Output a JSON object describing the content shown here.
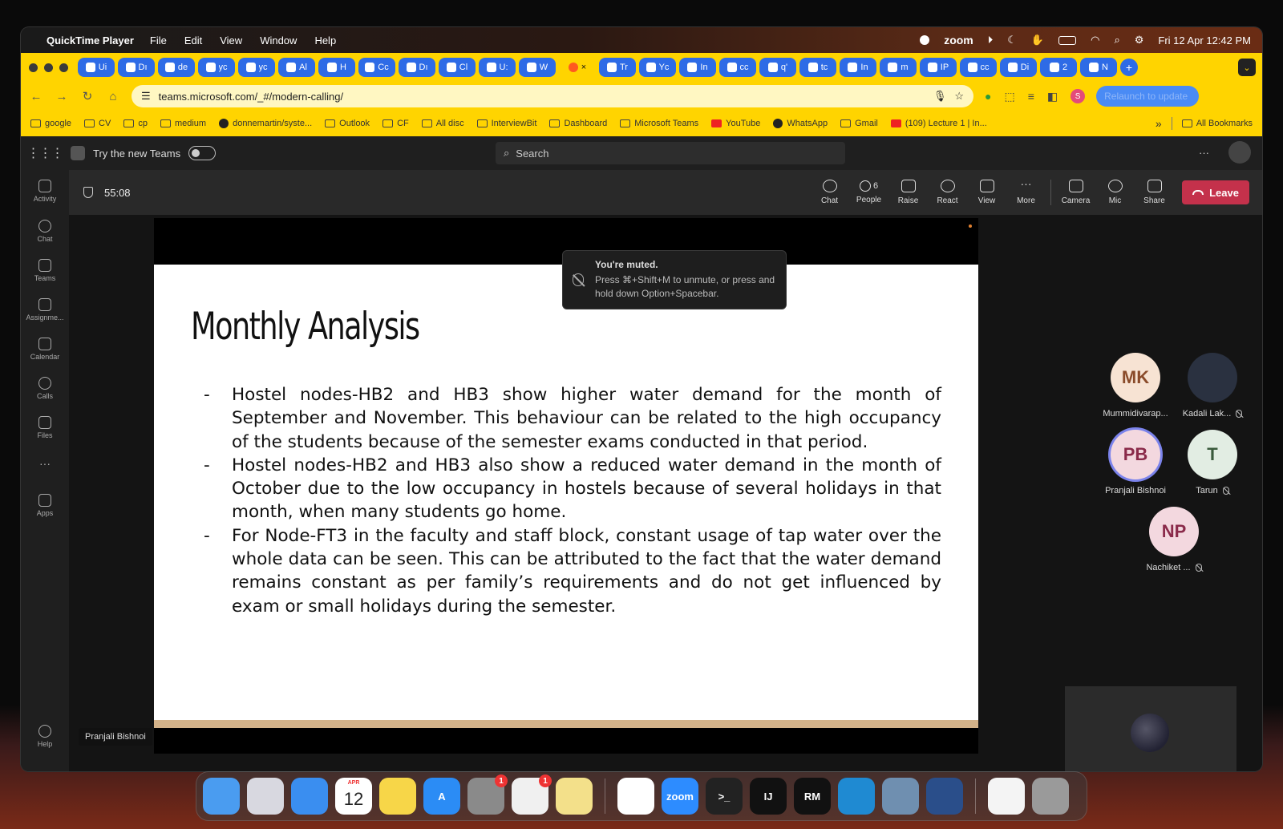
{
  "menubar": {
    "app_name": "QuickTime Player",
    "menus": [
      "File",
      "Edit",
      "View",
      "Window",
      "Help"
    ],
    "zoom_label": "zoom",
    "datetime": "Fri 12 Apr  12:42 PM"
  },
  "browser": {
    "tabs": [
      {
        "label": "Ui"
      },
      {
        "label": "Dı"
      },
      {
        "label": "de"
      },
      {
        "label": "yc"
      },
      {
        "label": "yc"
      },
      {
        "label": "Al"
      },
      {
        "label": "H"
      },
      {
        "label": "Cc"
      },
      {
        "label": "Dı"
      },
      {
        "label": "Cl"
      },
      {
        "label": "U:"
      },
      {
        "label": "W"
      },
      {
        "label": "×"
      },
      {
        "label": "Tr"
      },
      {
        "label": "Yc"
      },
      {
        "label": "In"
      },
      {
        "label": "cc"
      },
      {
        "label": "q'"
      },
      {
        "label": "tc"
      },
      {
        "label": "In"
      },
      {
        "label": "m"
      },
      {
        "label": "IP"
      },
      {
        "label": "cc"
      },
      {
        "label": "Di"
      },
      {
        "label": "2"
      },
      {
        "label": "N"
      }
    ],
    "url": "teams.microsoft.com/_#/modern-calling/",
    "relaunch_label": "Relaunch to update",
    "profile_initial": "S",
    "bookmarks": [
      "google",
      "CV",
      "cp",
      "medium",
      "donnemartin/syste...",
      "Outlook",
      "CF",
      "All disc",
      "InterviewBit",
      "Dashboard",
      "Microsoft Teams",
      "YouTube",
      "WhatsApp",
      "Gmail",
      "(109) Lecture 1 | In..."
    ],
    "bookmarks_overflow": "»",
    "all_bookmarks": "All Bookmarks"
  },
  "teams": {
    "try_new_teams": "Try the new Teams",
    "search_placeholder": "Search",
    "more_dots": "···",
    "rail": [
      {
        "label": "Activity"
      },
      {
        "label": "Chat"
      },
      {
        "label": "Teams"
      },
      {
        "label": "Assignme..."
      },
      {
        "label": "Calendar"
      },
      {
        "label": "Calls"
      },
      {
        "label": "Files"
      },
      {
        "label": "···"
      },
      {
        "label": "Apps"
      }
    ],
    "help_label": "Help",
    "meeting": {
      "timer": "55:08",
      "controls": {
        "chat": "Chat",
        "people": "People",
        "people_count": "6",
        "raise": "Raise",
        "react": "React",
        "view": "View",
        "more": "More",
        "camera": "Camera",
        "mic": "Mic",
        "share": "Share",
        "leave": "Leave"
      },
      "toast": {
        "title": "You're muted.",
        "body": "Press ⌘+Shift+M to unmute, or press and hold down Option+Spacebar."
      },
      "presenter_name": "Pranjali Bishnoi",
      "participants": [
        {
          "initials": "MK",
          "name": "Mummidivarap...",
          "bg": "#f7e3d3",
          "fg": "#8a4b2a",
          "muted": false
        },
        {
          "initials": "",
          "name": "Kadali Lak...",
          "bg": "#2a3140",
          "fg": "#ffffff",
          "muted": true
        },
        {
          "initials": "PB",
          "name": "Pranjali Bishnoi",
          "bg": "#f3d8df",
          "fg": "#8a2a4a",
          "muted": false
        },
        {
          "initials": "T",
          "name": "Tarun",
          "bg": "#e2ede3",
          "fg": "#3a5a3c",
          "muted": true
        },
        {
          "initials": "NP",
          "name": "Nachiket ...",
          "bg": "#f3d8df",
          "fg": "#8a2a4a",
          "muted": true
        }
      ]
    }
  },
  "slide": {
    "title": "Monthly Analysis",
    "bullets": [
      "Hostel nodes-HB2 and HB3 show higher water demand for the month of September and November. This behaviour can be related to the high occupancy of the students because of the semester exams conducted in that period.",
      "Hostel nodes-HB2 and HB3 also show a reduced water demand in the month of October due to the low occupancy in hostels because of several holidays in that month, when many students go home.",
      "For Node-FT3 in the faculty and staff block, constant usage of tap water over the whole data can be seen. This can be attributed to the fact that the water demand remains constant as per family’s requirements and do not get influenced by exam or small holidays during the semester."
    ]
  },
  "dock": {
    "apps": [
      {
        "name": "finder-icon",
        "label": "",
        "bg": "#4a9cf0"
      },
      {
        "name": "launchpad-icon",
        "label": "",
        "bg": "#d8d8e0"
      },
      {
        "name": "safari-icon",
        "label": "",
        "bg": "#3a8ef0"
      },
      {
        "name": "calendar-icon",
        "label": "12",
        "month": "APR",
        "bg": "#ffffff"
      },
      {
        "name": "notes-icon",
        "label": "",
        "bg": "#f7d648"
      },
      {
        "name": "app-store-icon",
        "label": "A",
        "bg": "#2b8cf5"
      },
      {
        "name": "system-settings-icon",
        "label": "",
        "bg": "#8a8a8a",
        "badge": "1"
      },
      {
        "name": "slack-icon",
        "label": "",
        "bg": "#f0f0f0",
        "badge": "1"
      },
      {
        "name": "stickies-icon",
        "label": "",
        "bg": "#f3e08a"
      },
      {
        "name": "chrome-icon",
        "label": "",
        "bg": "#ffffff"
      },
      {
        "name": "zoom-icon",
        "label": "zoom",
        "bg": "#2d8cff"
      },
      {
        "name": "terminal-icon",
        "label": ">_",
        "bg": "#222222"
      },
      {
        "name": "intellij-icon",
        "label": "IJ",
        "bg": "#111111"
      },
      {
        "name": "rubymine-icon",
        "label": "RM",
        "bg": "#111111"
      },
      {
        "name": "vscode-icon",
        "label": "",
        "bg": "#1f8ad2"
      },
      {
        "name": "preview-icon",
        "label": "",
        "bg": "#6f8fb0"
      },
      {
        "name": "quicktime-icon",
        "label": "",
        "bg": "#2a4e8a"
      },
      {
        "name": "textedit-icon",
        "label": "",
        "bg": "#f4f4f4"
      },
      {
        "name": "trash-icon",
        "label": "",
        "bg": "#9a9a9a"
      }
    ]
  }
}
